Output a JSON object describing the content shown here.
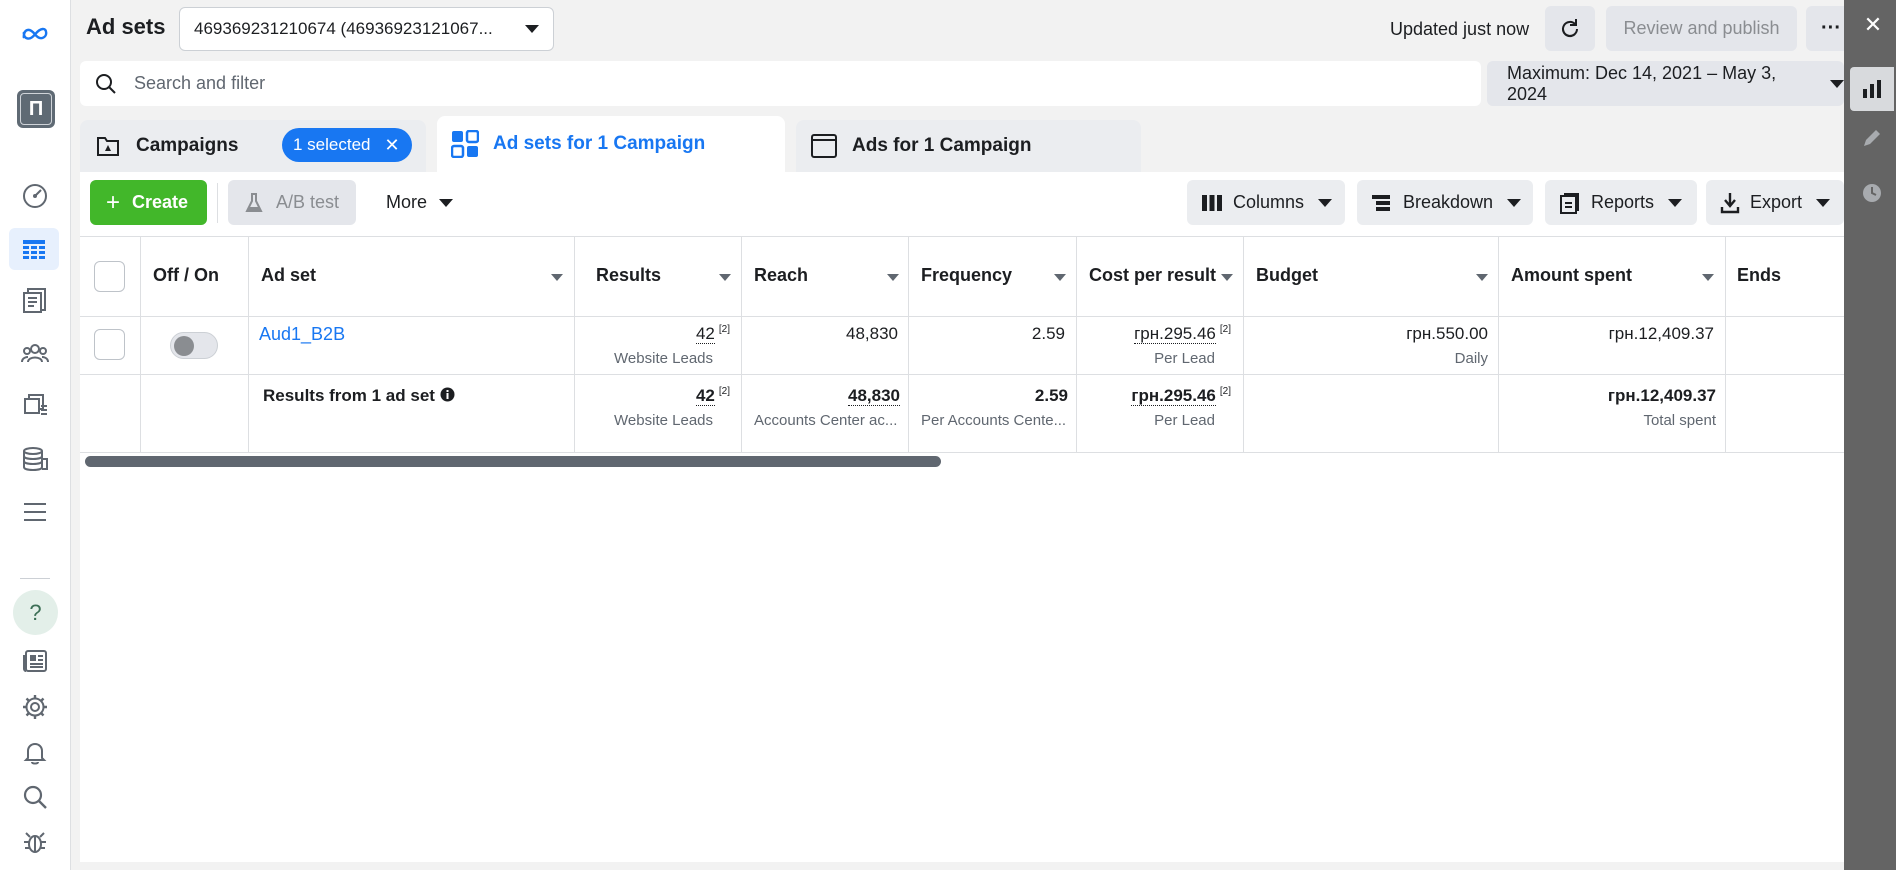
{
  "header": {
    "title": "Ad sets",
    "account_select": "469369231210674 (46936923121067...",
    "updated_text": "Updated just now",
    "review_label": "Review and publish"
  },
  "search": {
    "placeholder": "Search and filter"
  },
  "date_range": "Maximum: Dec 14, 2021 – May 3, 2024",
  "tabs": [
    {
      "label": "Campaigns"
    },
    {
      "label": "Ad sets for 1 Campaign"
    },
    {
      "label": "Ads for 1 Campaign"
    }
  ],
  "selected_pill": "1 selected",
  "toolbar": {
    "create": "Create",
    "ab_test": "A/B test",
    "more": "More",
    "columns": "Columns",
    "breakdown": "Breakdown",
    "reports": "Reports",
    "export": "Export"
  },
  "table": {
    "headers": [
      "Off / On",
      "Ad set",
      "Results",
      "Reach",
      "Frequency",
      "Cost per result",
      "Budget",
      "Amount spent",
      "Ends"
    ],
    "row": {
      "name": "Aud1_B2B",
      "toggle_on": false,
      "results": "42",
      "results_fn": "[2]",
      "results_sub": "Website Leads",
      "reach": "48,830",
      "frequency": "2.59",
      "cost": "грн.295.46",
      "cost_fn": "[2]",
      "cost_sub": "Per Lead",
      "budget": "грн.550.00",
      "budget_sub": "Daily",
      "spent": "грн.12,409.37"
    },
    "summary": {
      "label": "Results from 1 ad set",
      "results": "42",
      "results_fn": "[2]",
      "results_sub": "Website Leads",
      "reach": "48,830",
      "reach_sub": "Accounts Center ac...",
      "frequency": "2.59",
      "frequency_sub": "Per Accounts Cente...",
      "cost": "грн.295.46",
      "cost_fn": "[2]",
      "cost_sub": "Per Lead",
      "spent": "грн.12,409.37",
      "spent_sub": "Total spent"
    }
  },
  "colors": {
    "accent": "#1877f2",
    "create_green": "#42b72a",
    "panel_gray": "#646464"
  }
}
